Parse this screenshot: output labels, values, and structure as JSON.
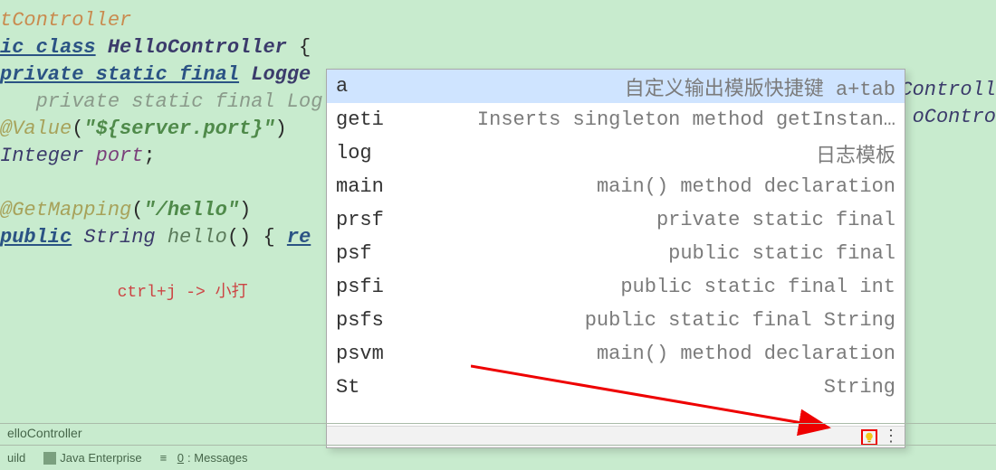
{
  "code": {
    "l0_ann": "tController",
    "l1_mod": "ic class",
    "l1_name": " HelloController",
    "l1_brace": " {",
    "l2_mod": "private static final",
    "l2_type": " Logge",
    "l3_gray": "   private static final Log",
    "l4_ann": "@Value",
    "l4_paren_open": "(",
    "l4_str": "\"${server.port}\"",
    "l4_paren_close": ")",
    "l5_type": "Integer",
    "l5_var": " port",
    "l5_semi": ";",
    "l6_ann": "@GetMapping",
    "l6_paren_open": "(",
    "l6_str": "\"/hello\"",
    "l6_paren_close": ")",
    "l7_mod": "public",
    "l7_type": " String",
    "l7_name": " hello",
    "l7_rest": "() { ",
    "l7_ret": "re",
    "hint": "            ctrl+j -> 小打"
  },
  "right": {
    "r1": "Controll",
    "r2": "oContro"
  },
  "popup": {
    "items": [
      {
        "abbr": "a",
        "desc": "自定义输出模版快捷键 a+tab"
      },
      {
        "abbr": "geti",
        "desc": "Inserts singleton method getInstan…"
      },
      {
        "abbr": "log",
        "desc": "日志模板"
      },
      {
        "abbr": "main",
        "desc": "main() method declaration"
      },
      {
        "abbr": "prsf",
        "desc": "private static final"
      },
      {
        "abbr": "psf",
        "desc": "public static final"
      },
      {
        "abbr": "psfi",
        "desc": "public static final int"
      },
      {
        "abbr": "psfs",
        "desc": "public static final String"
      },
      {
        "abbr": "psvm",
        "desc": "main() method declaration"
      },
      {
        "abbr": "St",
        "desc": "String"
      }
    ]
  },
  "status": {
    "crumb": "elloController",
    "build": "uild",
    "je": "Java Enterprise",
    "msg_u": "0",
    "msg_rest": ": Messages"
  }
}
